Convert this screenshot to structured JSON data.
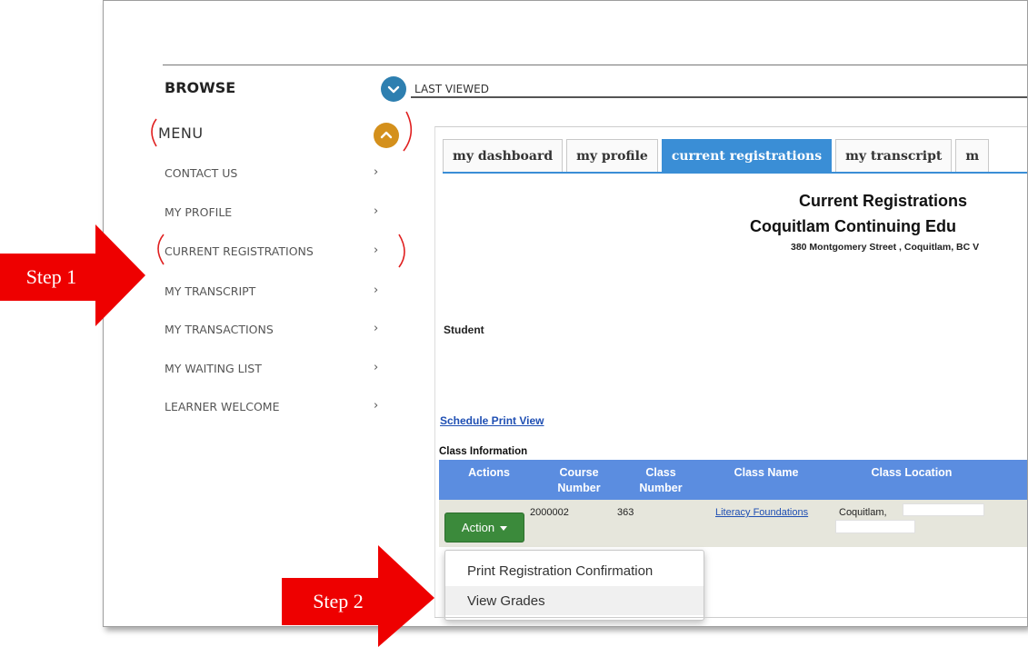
{
  "sidebar": {
    "browse_label": "BROWSE",
    "last_viewed_label": "LAST VIEWED",
    "menu_label": "MENU",
    "items": [
      {
        "label": "CONTACT US"
      },
      {
        "label": "MY PROFILE"
      },
      {
        "label": "CURRENT REGISTRATIONS"
      },
      {
        "label": "MY TRANSCRIPT"
      },
      {
        "label": "MY TRANSACTIONS"
      },
      {
        "label": "MY WAITING LIST"
      },
      {
        "label": "LEARNER WELCOME"
      }
    ],
    "chevron": "›"
  },
  "tabs": [
    {
      "label": "my dashboard"
    },
    {
      "label": "my profile"
    },
    {
      "label": "current registrations"
    },
    {
      "label": "my transcript"
    },
    {
      "label": "m"
    }
  ],
  "active_tab": "current registrations",
  "header": {
    "title": "Current Registrations",
    "org": "Coquitlam Continuing Edu",
    "address": "380 Montgomery Street , Coquitlam, BC V"
  },
  "student_label": "Student",
  "print_view_link": "Schedule Print View",
  "class_info_label": "Class Information",
  "table": {
    "columns": [
      "Actions",
      "Course Number",
      "Class Number",
      "Class Name",
      "Class Location"
    ],
    "columns_display": {
      "actions": "Actions",
      "course_number_1": "Course",
      "course_number_2": "Number",
      "class_number_1": "Class",
      "class_number_2": "Number",
      "class_name": "Class Name",
      "class_location": "Class Location"
    },
    "rows": [
      {
        "course_number": "2000002",
        "class_number": "363",
        "class_name": "Literacy Foundations",
        "class_location": "Coquitlam,"
      }
    ]
  },
  "action_button": {
    "label": "Action"
  },
  "action_menu": [
    {
      "label": "Print Registration Confirmation"
    },
    {
      "label": "View Grades"
    }
  ],
  "annotations": {
    "step1": "Step 1",
    "step2": "Step 2"
  },
  "colors": {
    "tab_active": "#3a8ed6",
    "table_header": "#5b8de0",
    "action_button": "#3b8a3b",
    "step_callout": "#ee0000",
    "browse_toggle": "#2e7fb0",
    "menu_toggle": "#d4901c"
  }
}
